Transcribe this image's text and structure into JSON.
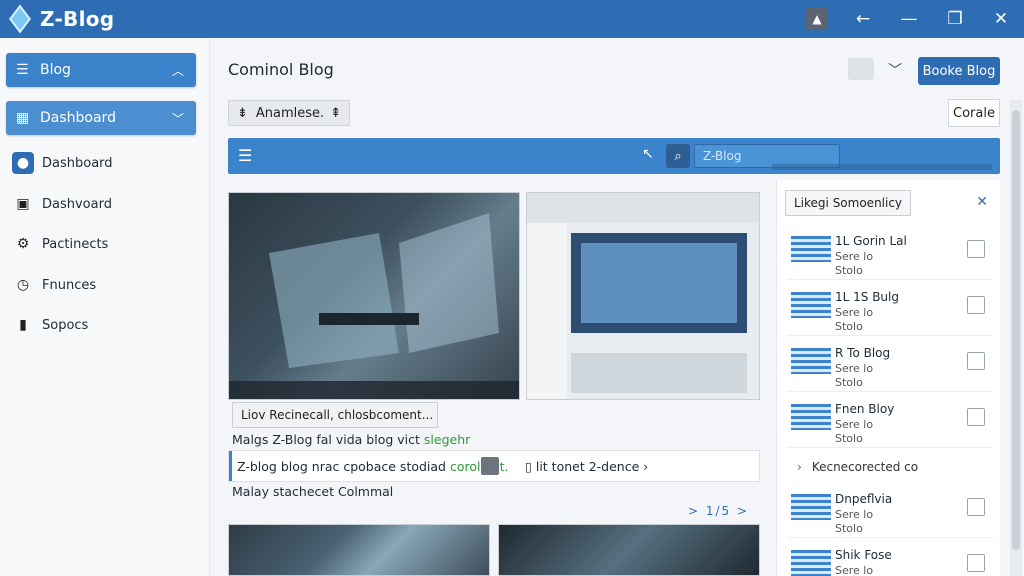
{
  "app": {
    "title": "Z-Blog"
  },
  "titlebar": {
    "icons": [
      "pin-icon",
      "back-arrow-icon",
      "minimize-icon",
      "restore-icon",
      "close-icon"
    ]
  },
  "sidebar": {
    "top_sections": [
      {
        "label": "Blog",
        "icon": "list-icon"
      },
      {
        "label": "Dashboard",
        "icon": "dashboard-icon"
      }
    ],
    "items": [
      {
        "label": "Dashboard",
        "icon": "drop-icon",
        "active": true
      },
      {
        "label": "Dashvoard",
        "icon": "calendar-icon"
      },
      {
        "label": "Pactinects",
        "icon": "gear-icon"
      },
      {
        "label": "Fnunces",
        "icon": "clock-icon"
      },
      {
        "label": "Sopocs",
        "icon": "book-icon"
      }
    ]
  },
  "header": {
    "title": "Cominol Blog",
    "primary_button": "Booke Blog",
    "chip": "Anamlese.",
    "secondary_button": "Corale"
  },
  "toolbar": {
    "search_placeholder": "Z-Blog"
  },
  "content": {
    "caption": "Liov Recinecall, chlosbcoment...",
    "line1": "Malgs Z-Blog fal vida blog vict",
    "line1_green": "slegehr",
    "row_text": "Z-blog blog nrac cpobace stodiad",
    "row_green": "corolient.",
    "row_right": "lit tonet 2-dence",
    "line2": "Malay stachecet Colmmal",
    "pager": "> 1/5 >"
  },
  "right_panel": {
    "chip": "Likegi Somoenlicy",
    "items": [
      {
        "title": "1L Gorin Lal",
        "sub": "Sere lo",
        "sub2": "Stolo"
      },
      {
        "title": "1L 1S Bulg",
        "sub": "Sere lo",
        "sub2": "Stolo"
      },
      {
        "title": "R To Blog",
        "sub": "Sere lo",
        "sub2": "Stolo"
      },
      {
        "title": "Fnen Bloy",
        "sub": "Sere lo",
        "sub2": "Stolo"
      },
      {
        "title": "Dnpeflvia",
        "sub": "Sere lo",
        "sub2": "Stolo"
      },
      {
        "title": "Shik Fose",
        "sub": "Sere lo",
        "sub2": ""
      }
    ],
    "link": "Kecnecorected co"
  }
}
